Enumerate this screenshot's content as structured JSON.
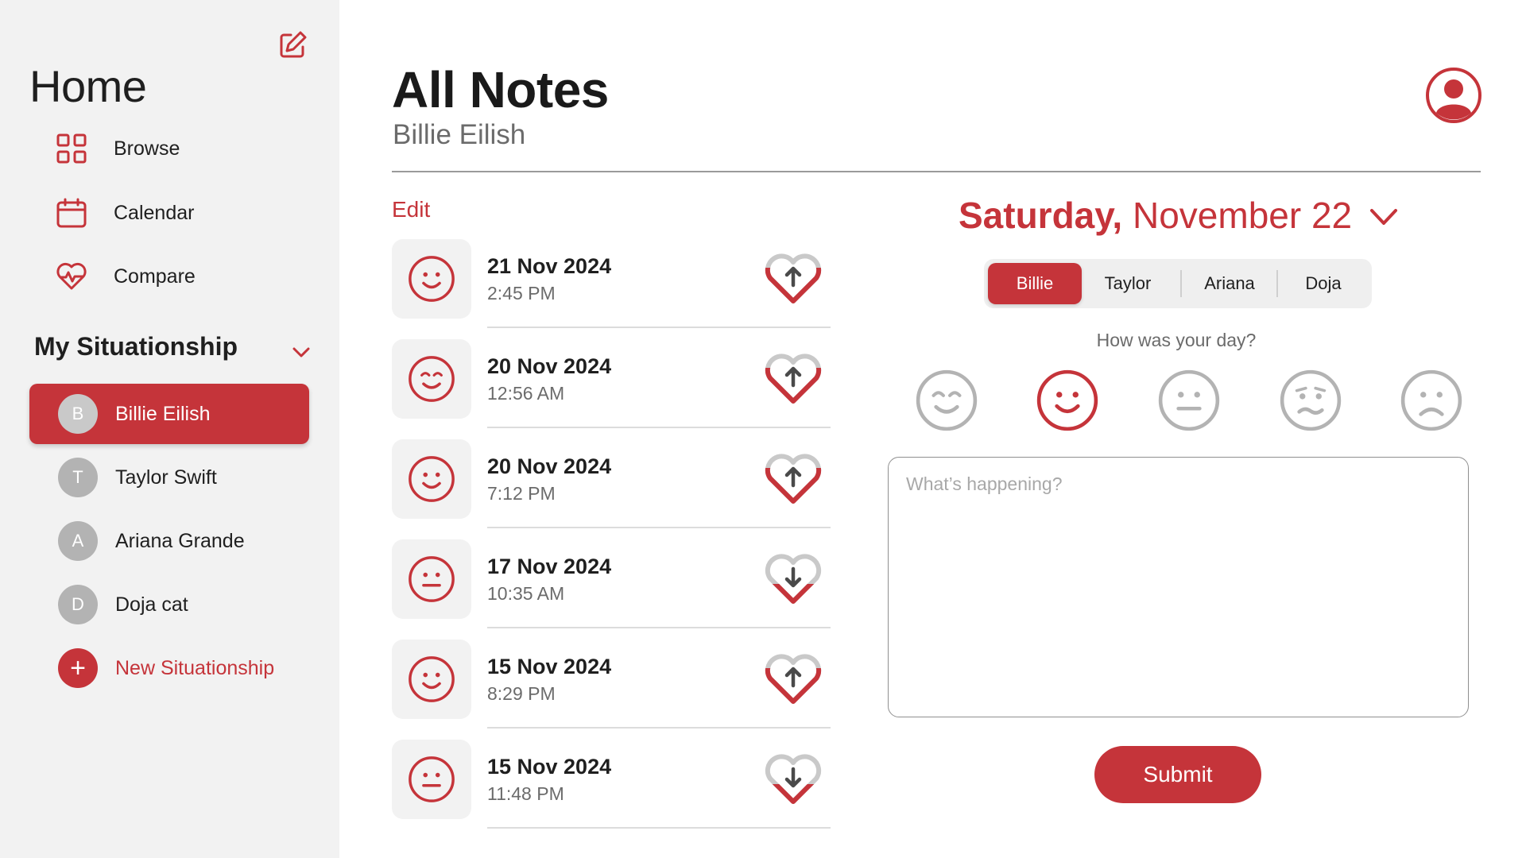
{
  "sidebar": {
    "title": "Home",
    "compose_icon": "edit-square-icon",
    "nav": [
      {
        "label": "Browse",
        "icon": "grid-icon"
      },
      {
        "label": "Calendar",
        "icon": "calendar-icon"
      },
      {
        "label": "Compare",
        "icon": "heart-pulse-icon"
      }
    ],
    "section_title": "My Situationship",
    "people": [
      {
        "initial": "B",
        "name": "Billie Eilish",
        "active": true
      },
      {
        "initial": "T",
        "name": "Taylor Swift",
        "active": false
      },
      {
        "initial": "A",
        "name": "Ariana Grande",
        "active": false
      },
      {
        "initial": "D",
        "name": "Doja cat",
        "active": false
      }
    ],
    "new_item": {
      "symbol": "+",
      "label": "New Situationship"
    }
  },
  "header": {
    "title": "All Notes",
    "subtitle": "Billie Eilish",
    "profile_icon": "user-circle-icon"
  },
  "notes": {
    "edit_label": "Edit",
    "items": [
      {
        "date": "21 Nov 2024",
        "time": "2:45 PM",
        "mood": "smile",
        "trend": "up"
      },
      {
        "date": "20 Nov 2024",
        "time": "12:56 AM",
        "mood": "content",
        "trend": "up"
      },
      {
        "date": "20 Nov 2024",
        "time": "7:12 PM",
        "mood": "smile",
        "trend": "up"
      },
      {
        "date": "17 Nov 2024",
        "time": "10:35 AM",
        "mood": "neutral",
        "trend": "down"
      },
      {
        "date": "15 Nov 2024",
        "time": "8:29 PM",
        "mood": "smile",
        "trend": "up"
      },
      {
        "date": "15 Nov 2024",
        "time": "11:48 PM",
        "mood": "neutral",
        "trend": "down"
      }
    ]
  },
  "entry": {
    "date_day": "Saturday,",
    "date_rest": "November 22",
    "tabs": [
      "Billie",
      "Taylor",
      "Ariana",
      "Doja"
    ],
    "active_tab": "Billie",
    "prompt": "How was your day?",
    "moods": [
      "content",
      "smile",
      "neutral",
      "worried",
      "sad"
    ],
    "selected_mood": "smile",
    "placeholder": "What’s happening?",
    "value": "",
    "submit_label": "Submit"
  },
  "colors": {
    "accent": "#c5343a",
    "sidebar_bg": "#f2f2f2",
    "muted_icon": "#b3b3b3"
  }
}
